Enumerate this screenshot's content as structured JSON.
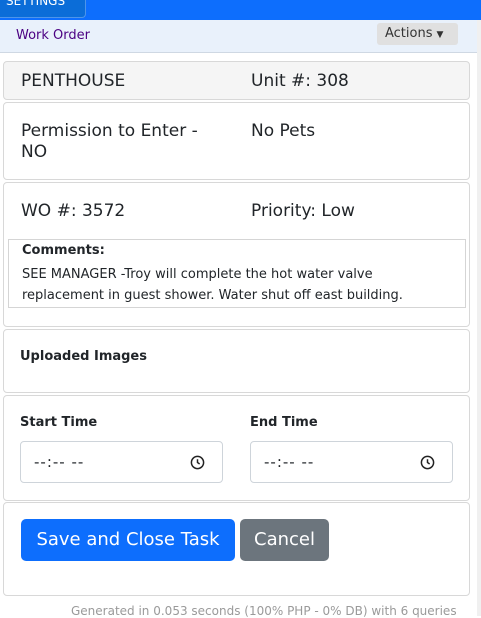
{
  "topbar": {
    "settings_tab": "SETTINGS"
  },
  "header": {
    "title": "Work Order",
    "actions_label": "Actions"
  },
  "unit": {
    "building": "PENTHOUSE",
    "unit_number": "Unit #: 308"
  },
  "access": {
    "permission_line1": "Permission to Enter -",
    "permission_line2": "NO",
    "pets": "No Pets"
  },
  "order": {
    "wo_number": "WO #: 3572",
    "priority": "Priority: Low"
  },
  "comments": {
    "title": "Comments:",
    "line1": "SEE MANAGER -Troy will complete the hot water valve",
    "line2": "replacement in guest shower. Water shut off east building."
  },
  "images": {
    "title": "Uploaded Images"
  },
  "times": {
    "start_label": "Start Time",
    "start_value": "--:-- --",
    "end_label": "End Time",
    "end_value": "--:-- --"
  },
  "buttons": {
    "save": "Save and Close Task",
    "cancel": "Cancel"
  },
  "footer": {
    "text": "Generated in 0.053 seconds (100% PHP - 0% DB) with 6 queries"
  },
  "colors": {
    "primary": "#0d6efd",
    "secondary": "#6c757d",
    "title": "#4b0082"
  },
  "icons": {
    "clock": "clock-icon",
    "caret": "caret-down-icon"
  }
}
